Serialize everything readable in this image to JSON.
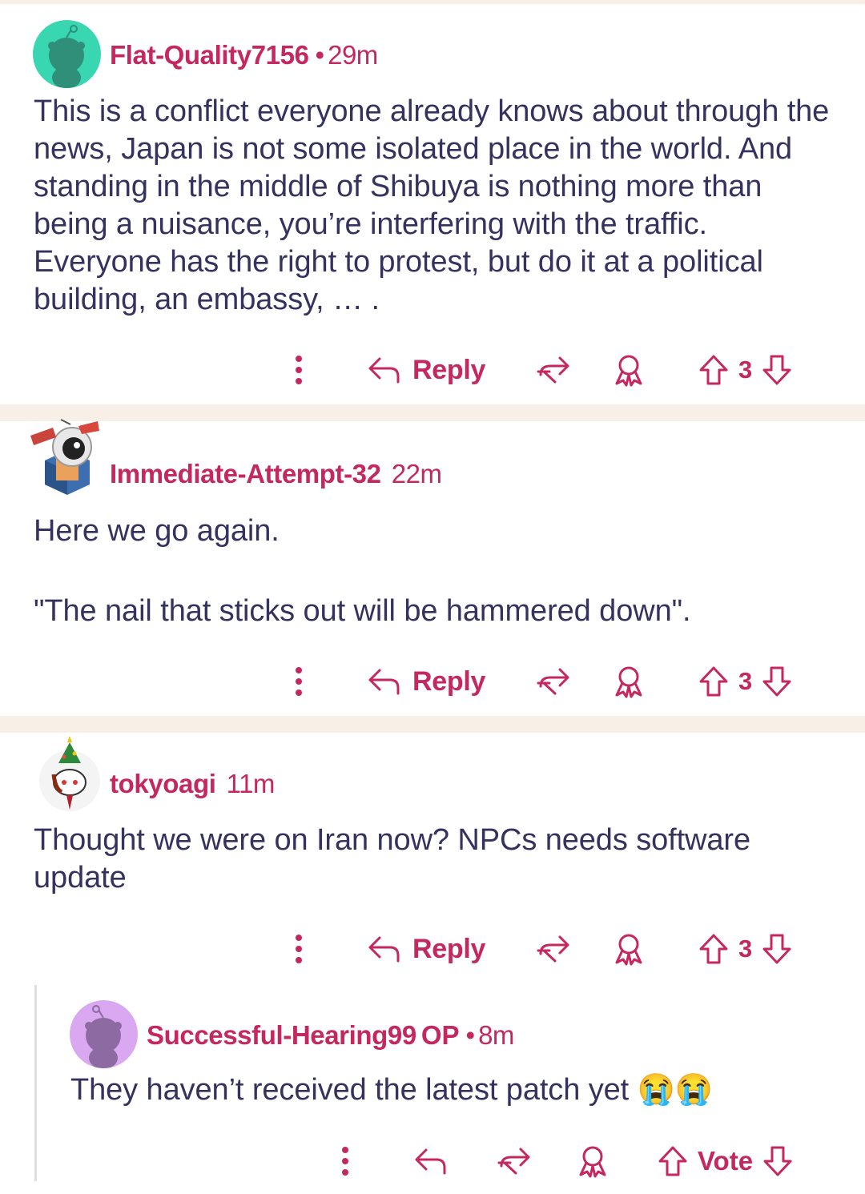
{
  "colors": {
    "accent": "#c4285e",
    "text": "#35325f",
    "separator": "#f8efe6",
    "avatar_teal": "#39d6b2",
    "avatar_purple": "#d9a8f1"
  },
  "comments": [
    {
      "username": "Flat-Quality7156",
      "dot": "•",
      "time": "29m",
      "avatar": "snoo-teal-avatar",
      "body": "This is a conflict everyone already knows about through the news, Japan is not some isolated place in the world. And standing in the middle of Shibuya is nothing more than being a nuisance, you’re interfering with the traffic. Everyone has the right to protest, but do it at a political building, an embassy, … .",
      "reply_label": "Reply",
      "votes": "3"
    },
    {
      "username": "Immediate-Attempt-32",
      "time": "22m",
      "avatar": "robot-avatar",
      "body": "Here we go again.\n\n\"The nail that sticks out will be hammered down\".",
      "reply_label": "Reply",
      "votes": "3"
    },
    {
      "username": "tokyoagi",
      "time": "11m",
      "avatar": "snoo-xmas-hat-avatar",
      "body": "Thought we were on Iran now? NPCs needs software update",
      "reply_label": "Reply",
      "votes": "3"
    },
    {
      "username": "Successful-Hearing99",
      "op_badge": "OP",
      "dot": "•",
      "time": "8m",
      "avatar": "snoo-purple-avatar",
      "body": "They haven’t received the latest patch yet 😭😭",
      "reply_label": "",
      "votes": "Vote"
    }
  ],
  "icons": [
    "more-icon",
    "reply-icon",
    "share-icon",
    "award-icon",
    "upvote-icon",
    "downvote-icon"
  ]
}
